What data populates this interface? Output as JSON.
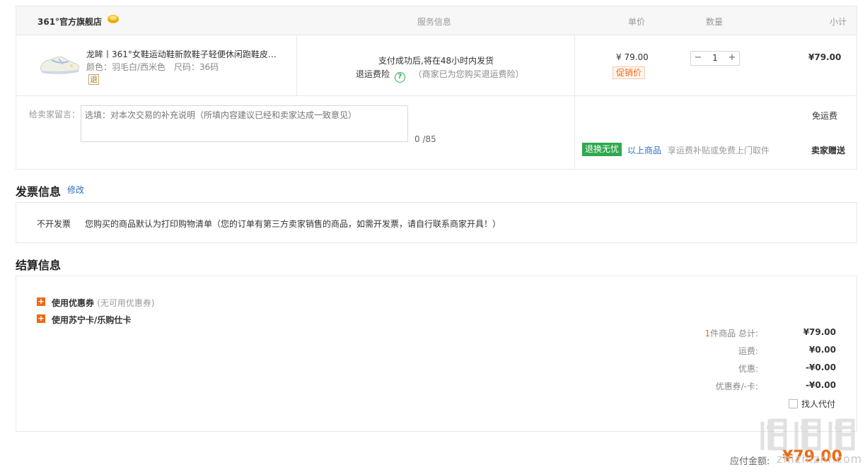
{
  "order": {
    "store_name": "361°官方旗舰店",
    "columns": {
      "service": "服务信息",
      "unit_price": "单价",
      "quantity": "数量",
      "subtotal": "小计"
    },
    "item": {
      "title": "龙眸丨361°女鞋运动鞋新款鞋子轻便休闲跑鞋皮面...",
      "color": "颜色：羽毛白/西米色",
      "size": "尺码：36码",
      "return_badge": "退",
      "service_line1": "支付成功后,将在48小时内发货",
      "service_insurance": "退运费险",
      "service_note": "（商家已为您购买退运费险）",
      "unit_price": "¥ 79.00",
      "promo": "促销价",
      "quantity": "1",
      "subtotal": "¥79.00"
    },
    "message": {
      "label": "给卖家留言：",
      "placeholder": "选填：对本次交易的补充说明（所填内容建议已经和卖家达成一致意见）",
      "count": "0 /85"
    },
    "shipping": {
      "free": "免运费",
      "return_badge": "退换无忧",
      "above_goods": "以上商品",
      "note": "享运费补贴或免费上门取件",
      "seller_gift": "卖家赠送"
    }
  },
  "invoice": {
    "title": "发票信息",
    "edit": "修改",
    "type": "不开发票",
    "desc": "您购买的商品默认为打印购物清单（您的订单有第三方卖家销售的商品，如需开发票，请自行联系商家开具！）"
  },
  "settlement": {
    "title": "结算信息",
    "coupon_label": "使用优惠券",
    "coupon_sub": "(无可用优惠券)",
    "card_label": "使用苏宁卡/乐购仕卡",
    "summary": {
      "count": "1",
      "count_suffix": "件商品 总计:",
      "total": "¥79.00",
      "freight_label": "运费:",
      "freight": "¥0.00",
      "discount_label": "优惠:",
      "discount": "-¥0.00",
      "coupon_card_label": "优惠券/-卡:",
      "coupon_card": "-¥0.00",
      "proxy_pay": "找人代付"
    },
    "payable_label": "应付金额:",
    "payable": "¥79.00"
  },
  "watermark": {
    "text": "zhizhizhi.com"
  },
  "colors": {
    "accent_orange": "#ec6a16",
    "link_blue": "#2a6fbd",
    "badge_green": "#2fa84f"
  }
}
